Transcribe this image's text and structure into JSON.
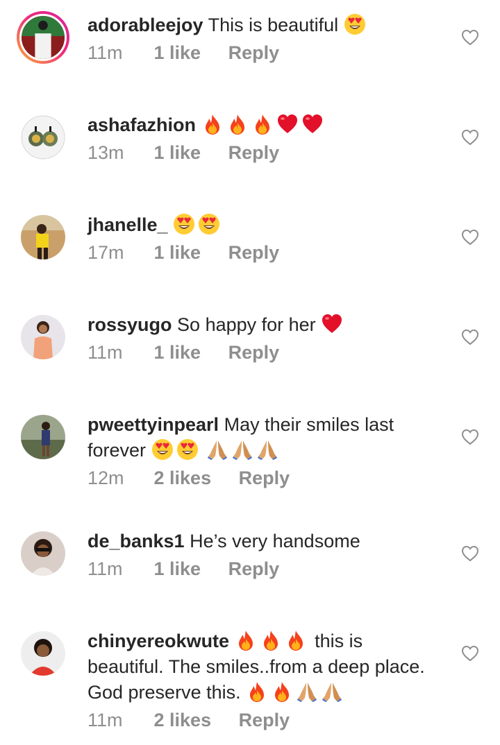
{
  "colors": {
    "text": "#262626",
    "meta": "#8e8e8e",
    "story_ring_start": "#f9b13a",
    "story_ring_end": "#d6249f"
  },
  "comments": [
    {
      "username": "adorableejoy",
      "text": "This is beautiful",
      "emojis": [
        "heart-eyes-emoji"
      ],
      "time": "11m",
      "likes": "1 like",
      "reply": "Reply",
      "avatar_icon": "avatar-adorableejoy",
      "story_ring": true
    },
    {
      "username": "ashafazhion",
      "text": "",
      "emojis": [
        "fire-emoji",
        "fire-emoji",
        "fire-emoji",
        "red-heart-emoji",
        "red-heart-emoji"
      ],
      "time": "13m",
      "likes": "1 like",
      "reply": "Reply",
      "avatar_icon": "avatar-ashafazhion",
      "story_ring": false
    },
    {
      "username": "jhanelle_",
      "text": "",
      "emojis": [
        "heart-eyes-emoji",
        "heart-eyes-emoji"
      ],
      "time": "17m",
      "likes": "1 like",
      "reply": "Reply",
      "avatar_icon": "avatar-jhanelle",
      "story_ring": false
    },
    {
      "username": "rossyugo",
      "text": "So happy for her",
      "emojis": [
        "red-heart-emoji"
      ],
      "time": "11m",
      "likes": "1 like",
      "reply": "Reply",
      "avatar_icon": "avatar-rossyugo",
      "story_ring": false
    },
    {
      "username": "pweettyinpearl",
      "text_line1": "May their smiles last",
      "text_line2": "forever",
      "emojis": [
        "heart-eyes-emoji",
        "heart-eyes-emoji",
        "folded-hands-emoji",
        "folded-hands-emoji",
        "folded-hands-emoji"
      ],
      "time": "12m",
      "likes": "2 likes",
      "reply": "Reply",
      "avatar_icon": "avatar-pweettyinpearl",
      "story_ring": false
    },
    {
      "username": "de_banks1",
      "text": "He’s very handsome",
      "emojis": [],
      "time": "11m",
      "likes": "1 like",
      "reply": "Reply",
      "avatar_icon": "avatar-de-banks1",
      "story_ring": false
    },
    {
      "username": "chinyereokwute",
      "text_after_emoji": "this is",
      "text_line2": "beautiful. The smiles..from a deep place.",
      "text_line3": "God preserve this.",
      "emojis_line1": [
        "fire-emoji",
        "fire-emoji",
        "fire-emoji"
      ],
      "emojis_line3": [
        "fire-emoji",
        "fire-emoji",
        "folded-hands-emoji",
        "folded-hands-emoji"
      ],
      "time": "11m",
      "likes": "2 likes",
      "reply": "Reply",
      "avatar_icon": "avatar-chinyereokwute",
      "story_ring": false
    }
  ],
  "like_icon": "heart-outline-icon"
}
